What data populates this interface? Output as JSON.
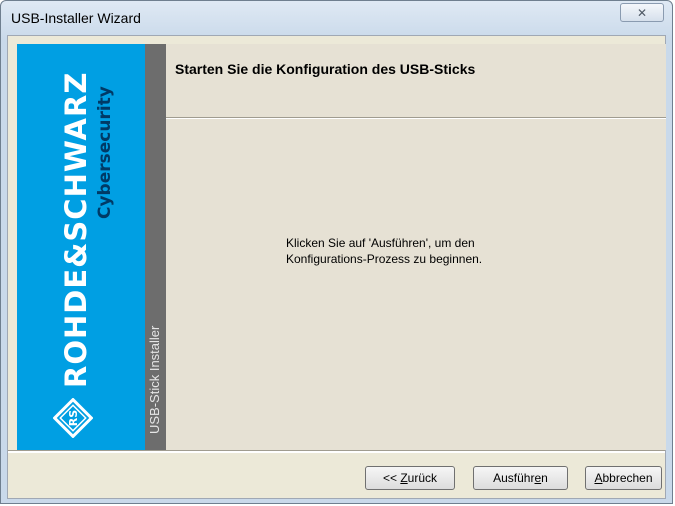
{
  "window": {
    "title": "USB-Installer Wizard",
    "close_glyph": "✕"
  },
  "brand": {
    "name": "ROHDE&SCHWARZ",
    "sub": "Cybersecurity",
    "badge_text": "RS",
    "panel_color": "#009fe3"
  },
  "side": {
    "label": "USB-Stick Installer"
  },
  "header": {
    "title": "Starten Sie die Konfiguration des USB-Sticks"
  },
  "content": {
    "line1": "Klicken Sie auf 'Ausführen', um den",
    "line2": "Konfigurations-Prozess zu beginnen."
  },
  "buttons": {
    "back": {
      "pre": "<< ",
      "accel": "Z",
      "post": "urück"
    },
    "run": {
      "pre": "Ausführ",
      "accel": "e",
      "post": "n"
    },
    "cancel": {
      "pre": "",
      "accel": "A",
      "post": "bbrechen"
    }
  }
}
